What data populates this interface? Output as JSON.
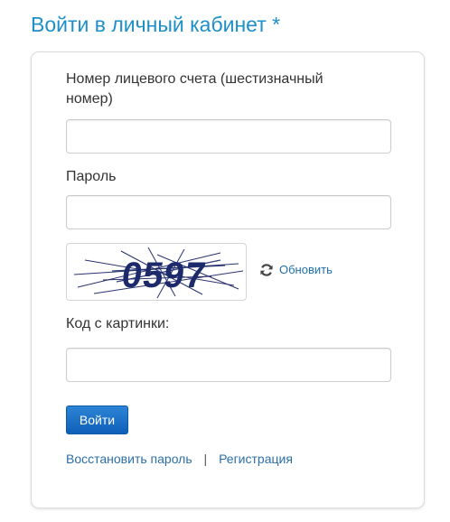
{
  "page": {
    "title": "Войти в личный кабинет *"
  },
  "form": {
    "account_label": "Номер лицевого счета (шестизначный номер)",
    "account_value": "",
    "password_label": "Пароль",
    "password_value": "",
    "captcha": {
      "text": "0597",
      "refresh_label": "Обновить",
      "refresh_icon": "refresh-icon"
    },
    "code_label": "Код с картинки:",
    "code_value": "",
    "submit_label": "Войти"
  },
  "links": {
    "restore_password": "Восстановить пароль",
    "separator": "|",
    "register": "Регистрация"
  },
  "colors": {
    "title": "#1e8fc8",
    "link": "#1f6fb0",
    "button": "#0e60b8",
    "captcha_text": "#1c2a6b"
  }
}
